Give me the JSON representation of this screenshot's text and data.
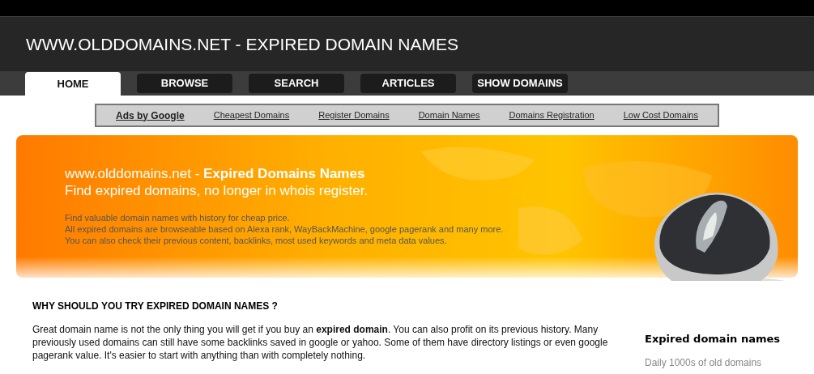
{
  "header": {
    "title": "WWW.OLDDOMAINS.NET - EXPIRED DOMAIN NAMES"
  },
  "nav": [
    {
      "label": "HOME",
      "selected": true
    },
    {
      "label": "BROWSE",
      "selected": false
    },
    {
      "label": "SEARCH",
      "selected": false
    },
    {
      "label": "ARTICLES",
      "selected": false
    },
    {
      "label": "SHOW DOMAINS",
      "selected": false
    }
  ],
  "ads": {
    "label": "Ads by Google",
    "links": [
      "Cheapest Domains",
      "Register Domains",
      "Domain Names",
      "Domains Registration",
      "Low Cost Domains"
    ]
  },
  "banner": {
    "title": "www.olddomains.net - **Expired Domains Names**",
    "subtitle": "Find expired domains, no longer in whois register.",
    "lines": [
      "Find valuable domain names with history for cheap price.",
      "All expired domains are browseable based on Alexa rank, WayBackMachine, google pagerank and many more.",
      "You can also check their previous content, backlinks, most used keywords and meta data values."
    ]
  },
  "article": {
    "heading": "WHY SHOULD YOU TRY EXPIRED DOMAIN NAMES ?",
    "paragraph": "Great domain name is not the only thing you will get if you buy an **expired domain**. You can also profit on its previous history. Many previously used domains can still have some backlinks saved in google or yahoo. Some of them have directory listings or even google pagerank value. It's easier to start with anything than with completely nothing."
  },
  "sidebar": {
    "heading": "Expired domain names",
    "text": "Daily 1000s of old domains"
  }
}
